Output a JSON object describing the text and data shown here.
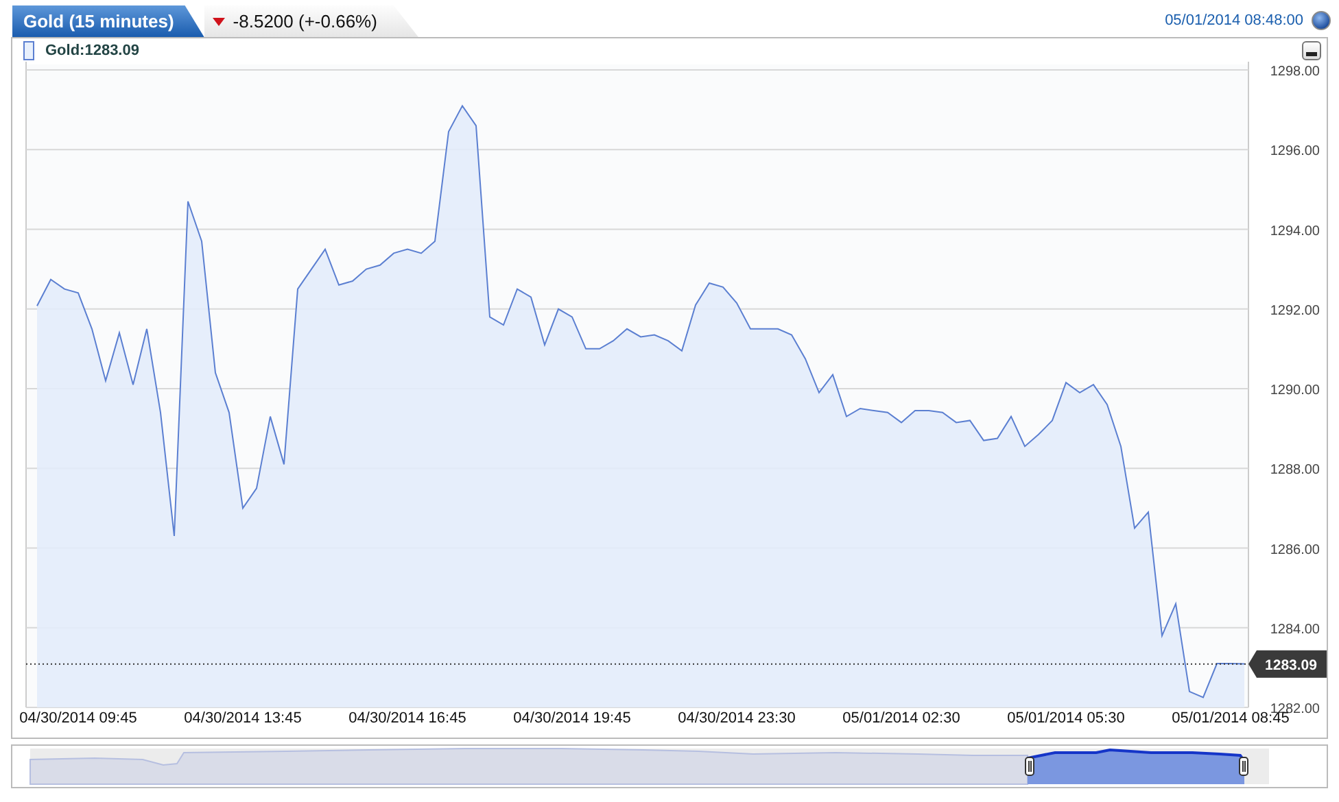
{
  "header": {
    "tab": {
      "title": "Gold (15 minutes)"
    },
    "change": {
      "negative": true,
      "text": "-8.5200 (+-0.66%)"
    },
    "timestamp": "05/01/2014 08:48:00"
  },
  "legend": {
    "label": "Gold:1283.09"
  },
  "chart": {
    "last_price": "1283.09",
    "chart_data": {
      "type": "area",
      "categories": [
        null,
        null,
        null,
        "04/30/2014 09:45",
        null,
        null,
        null,
        null,
        null,
        null,
        null,
        null,
        null,
        null,
        null,
        "04/30/2014 13:45",
        null,
        null,
        null,
        null,
        null,
        null,
        null,
        null,
        null,
        null,
        null,
        "04/30/2014 16:45",
        null,
        null,
        null,
        null,
        null,
        null,
        null,
        null,
        null,
        null,
        null,
        "04/30/2014 19:45",
        null,
        null,
        null,
        null,
        null,
        null,
        null,
        null,
        null,
        null,
        null,
        "04/30/2014 23:30",
        null,
        null,
        null,
        null,
        null,
        null,
        null,
        null,
        null,
        null,
        null,
        "05/01/2014 02:30",
        null,
        null,
        null,
        null,
        null,
        null,
        null,
        null,
        null,
        null,
        null,
        "05/01/2014 05:30",
        null,
        null,
        null,
        null,
        null,
        null,
        null,
        null,
        null,
        null,
        null,
        "05/01/2014 08:45",
        null
      ],
      "series": [
        {
          "color": "#5b7fd1",
          "values": [
            1292.08,
            1292.74,
            1292.5,
            1292.4,
            1291.5,
            1290.2,
            1291.4,
            1290.1,
            1291.5,
            1289.4,
            1286.3,
            1294.7,
            1293.7,
            1290.4,
            1289.4,
            1287.0,
            1287.5,
            1289.3,
            1288.1,
            1292.5,
            1293.0,
            1293.5,
            1292.6,
            1292.7,
            1293.0,
            1293.1,
            1293.4,
            1293.5,
            1293.4,
            1293.7,
            1296.45,
            1297.1,
            1296.6,
            1291.8,
            1291.6,
            1292.5,
            1292.3,
            1291.1,
            1292.0,
            1291.8,
            1291.0,
            1291.0,
            1291.2,
            1291.5,
            1291.3,
            1291.35,
            1291.2,
            1290.95,
            1292.1,
            1292.65,
            1292.55,
            1292.15,
            1291.5,
            1291.5,
            1291.5,
            1291.35,
            1290.75,
            1289.9,
            1290.35,
            1289.3,
            1289.5,
            1289.45,
            1289.4,
            1289.15,
            1289.45,
            1289.45,
            1289.4,
            1289.15,
            1289.2,
            1288.7,
            1288.75,
            1289.3,
            1288.55,
            1288.85,
            1289.2,
            1290.15,
            1289.9,
            1290.1,
            1289.6,
            1288.55,
            1286.5,
            1286.9,
            1283.8,
            1284.6,
            1282.4,
            1282.25,
            1283.1,
            1283.1,
            1283.09
          ]
        }
      ],
      "ylim": [
        1282,
        1298
      ],
      "yticks": [
        {
          "value": 1282,
          "label": "1282.00"
        },
        {
          "value": 1284,
          "label": "1284.00"
        },
        {
          "value": 1286,
          "label": "1286.00"
        },
        {
          "value": 1288,
          "label": "1288.00"
        },
        {
          "value": 1290,
          "label": "1290.00"
        },
        {
          "value": 1292,
          "label": "1292.00"
        },
        {
          "value": 1294,
          "label": "1294.00"
        },
        {
          "value": 1296,
          "label": "1296.00"
        },
        {
          "value": 1298,
          "label": "1298.00"
        }
      ],
      "grid": true,
      "ref_lines": [
        {
          "axis": "y",
          "value": 1283.09
        }
      ]
    }
  }
}
